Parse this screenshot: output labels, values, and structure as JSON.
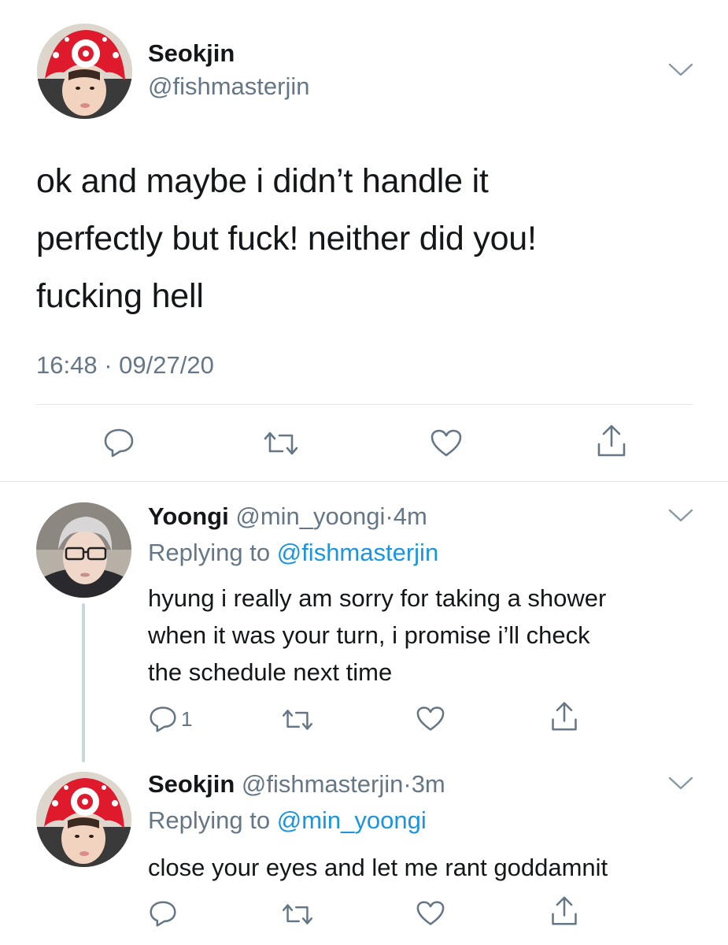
{
  "main_tweet": {
    "display_name": "Seokjin",
    "handle": "@fishmasterjin",
    "text_lines": [
      "ok and maybe i didn’t handle it",
      "perfectly but fuck! neither did you!",
      "fucking hell"
    ],
    "time": "16:48",
    "separator": "·",
    "date": "09/27/20"
  },
  "replies": [
    {
      "display_name": "Yoongi",
      "handle": "@min_yoongi",
      "separator": "·",
      "age": "4m",
      "replying_prefix": "Replying to",
      "replying_to": "@fishmasterjin",
      "text_lines": [
        "hyung i really am sorry for taking a shower",
        "when it was your turn, i promise i’ll check",
        "the schedule next time"
      ],
      "reply_count": "1"
    },
    {
      "display_name": "Seokjin",
      "handle": "@fishmasterjin",
      "separator": "·",
      "age": "3m",
      "replying_prefix": "Replying to",
      "replying_to": "@min_yoongi",
      "text_lines": [
        "close your eyes and let me rant goddamnit"
      ],
      "reply_count": ""
    }
  ],
  "icons": {
    "reply": "reply-icon",
    "retweet": "retweet-icon",
    "like": "heart-icon",
    "share": "share-icon",
    "more": "chevron-down-icon"
  },
  "colors": {
    "text": "#14171a",
    "muted": "#657786",
    "link": "#1b95e0",
    "divider": "#e1e8ed",
    "thread_line": "#ccd6dd"
  }
}
